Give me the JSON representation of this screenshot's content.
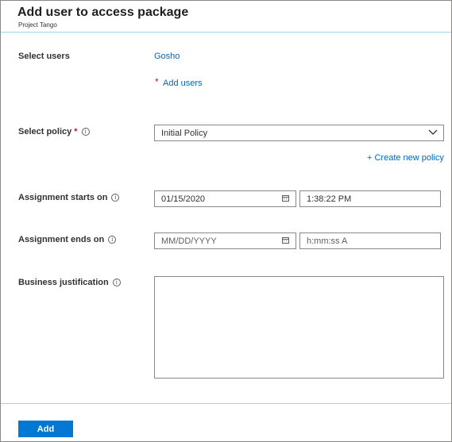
{
  "header": {
    "title": "Add user to access package",
    "subtitle": "Project Tango"
  },
  "select_users": {
    "label": "Select users",
    "selected_user": "Gosho",
    "add_users_link": "Add users",
    "required_marker": "*"
  },
  "select_policy": {
    "label": "Select policy",
    "required_marker": "*",
    "info_glyph": "i",
    "selected_value": "Initial Policy",
    "create_link": "+ Create new policy"
  },
  "assignment_start": {
    "label": "Assignment starts on",
    "info_glyph": "i",
    "date_value": "01/15/2020",
    "time_value": "1:38:22 PM"
  },
  "assignment_end": {
    "label": "Assignment ends on",
    "info_glyph": "i",
    "date_placeholder": "MM/DD/YYYY",
    "time_placeholder": "h:mm:ss A"
  },
  "justification": {
    "label": "Business justification",
    "info_glyph": "i",
    "value": ""
  },
  "footer": {
    "add_label": "Add"
  },
  "colors": {
    "link": "#0067b8",
    "primary_button": "#0078d4",
    "required": "#a4262c",
    "header_divider": "#9fd7e6"
  },
  "icons": {
    "calendar": "calendar-icon",
    "dropdown": "chevron-down-icon",
    "info": "info-icon"
  }
}
